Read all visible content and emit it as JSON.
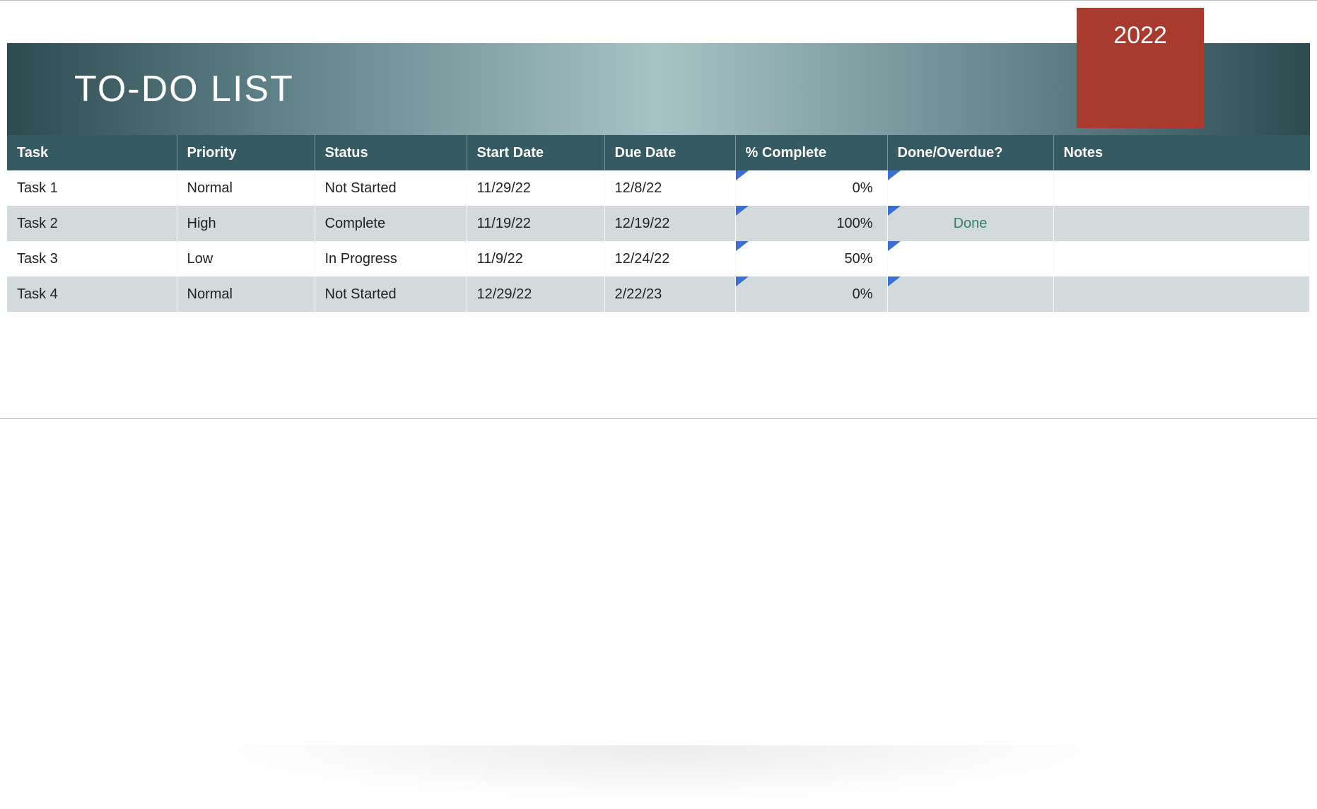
{
  "header": {
    "year": "2022",
    "title": "TO-DO LIST"
  },
  "table": {
    "columns": {
      "task": "Task",
      "priority": "Priority",
      "status": "Status",
      "start_date": "Start Date",
      "due_date": "Due Date",
      "pct_complete": "% Complete",
      "done_overdue": "Done/Overdue?",
      "notes": "Notes"
    },
    "rows": [
      {
        "task": "Task 1",
        "priority": "Normal",
        "status": "Not Started",
        "start_date": "11/29/22",
        "due_date": "12/8/22",
        "pct_complete": "0%",
        "done_overdue": "",
        "notes": ""
      },
      {
        "task": "Task 2",
        "priority": "High",
        "status": "Complete",
        "start_date": "11/19/22",
        "due_date": "12/19/22",
        "pct_complete": "100%",
        "done_overdue": "Done",
        "notes": ""
      },
      {
        "task": "Task 3",
        "priority": "Low",
        "status": "In Progress",
        "start_date": "11/9/22",
        "due_date": "12/24/22",
        "pct_complete": "50%",
        "done_overdue": "",
        "notes": ""
      },
      {
        "task": "Task 4",
        "priority": "Normal",
        "status": "Not Started",
        "start_date": "12/29/22",
        "due_date": "2/22/23",
        "pct_complete": "0%",
        "done_overdue": "",
        "notes": ""
      }
    ]
  }
}
